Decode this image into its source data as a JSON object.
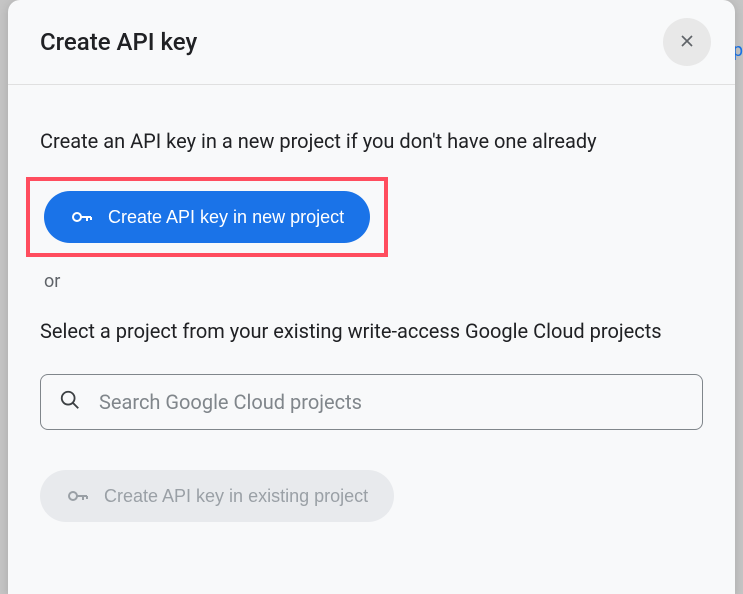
{
  "modal": {
    "title": "Create API key",
    "instruction_new": "Create an API key in a new project if you don't have one already",
    "create_new_label": "Create API key in new project",
    "or_label": "or",
    "instruction_existing": "Select a project from your existing write-access Google Cloud projects",
    "search_placeholder": "Search Google Cloud projects",
    "create_existing_label": "Create API key in existing project"
  }
}
